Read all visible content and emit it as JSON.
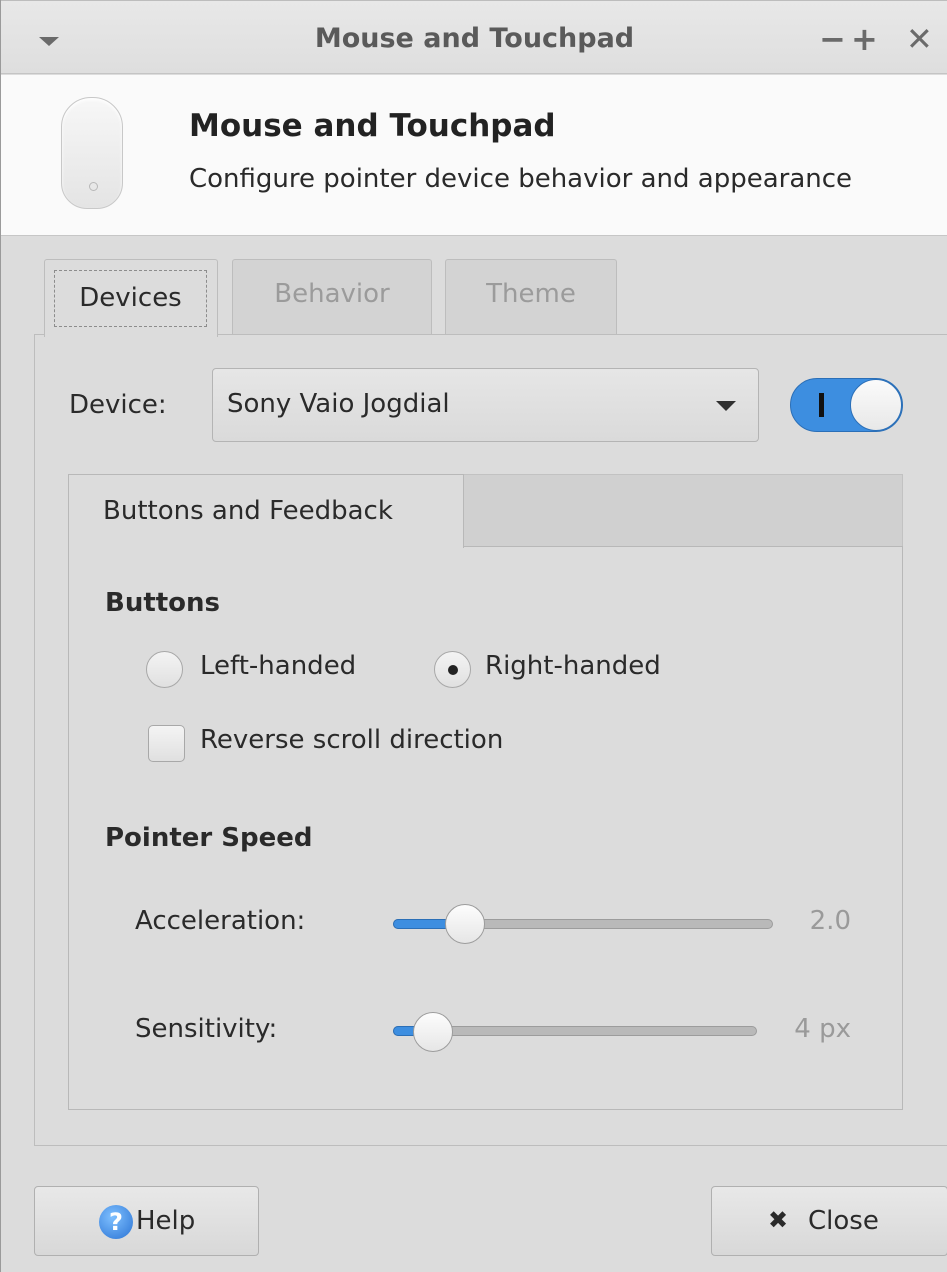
{
  "window": {
    "title": "Mouse and Touchpad",
    "minimize_glyph": "−",
    "maximize_glyph": "+",
    "close_glyph": "✕"
  },
  "header": {
    "title": "Mouse and Touchpad",
    "subtitle": "Configure pointer device behavior and appearance",
    "icon": "mouse-icon"
  },
  "tabs": [
    {
      "label": "Devices",
      "active": true
    },
    {
      "label": "Behavior",
      "active": false
    },
    {
      "label": "Theme",
      "active": false
    }
  ],
  "device": {
    "label": "Device:",
    "selected": "Sony Vaio Jogdial",
    "enabled": true
  },
  "inner_tab": {
    "label": "Buttons and Feedback"
  },
  "buttons_section": {
    "title": "Buttons",
    "left_handed": {
      "label": "Left-handed",
      "checked": false
    },
    "right_handed": {
      "label": "Right-handed",
      "checked": true
    },
    "reverse_scroll": {
      "label": "Reverse scroll direction",
      "checked": false
    }
  },
  "pointer_speed": {
    "title": "Pointer Speed",
    "acceleration": {
      "label": "Acceleration:",
      "value_text": "2.0",
      "fraction": 0.19
    },
    "sensitivity": {
      "label": "Sensitivity:",
      "value_text": "4 px",
      "fraction": 0.11
    }
  },
  "footer": {
    "help_label": "Help",
    "help_icon": "help-icon",
    "close_label": "Close",
    "close_icon": "close-icon"
  },
  "colors": {
    "accent": "#3d8ee0",
    "window_bg": "#dcdcdc",
    "header_bg": "#fafafa"
  }
}
